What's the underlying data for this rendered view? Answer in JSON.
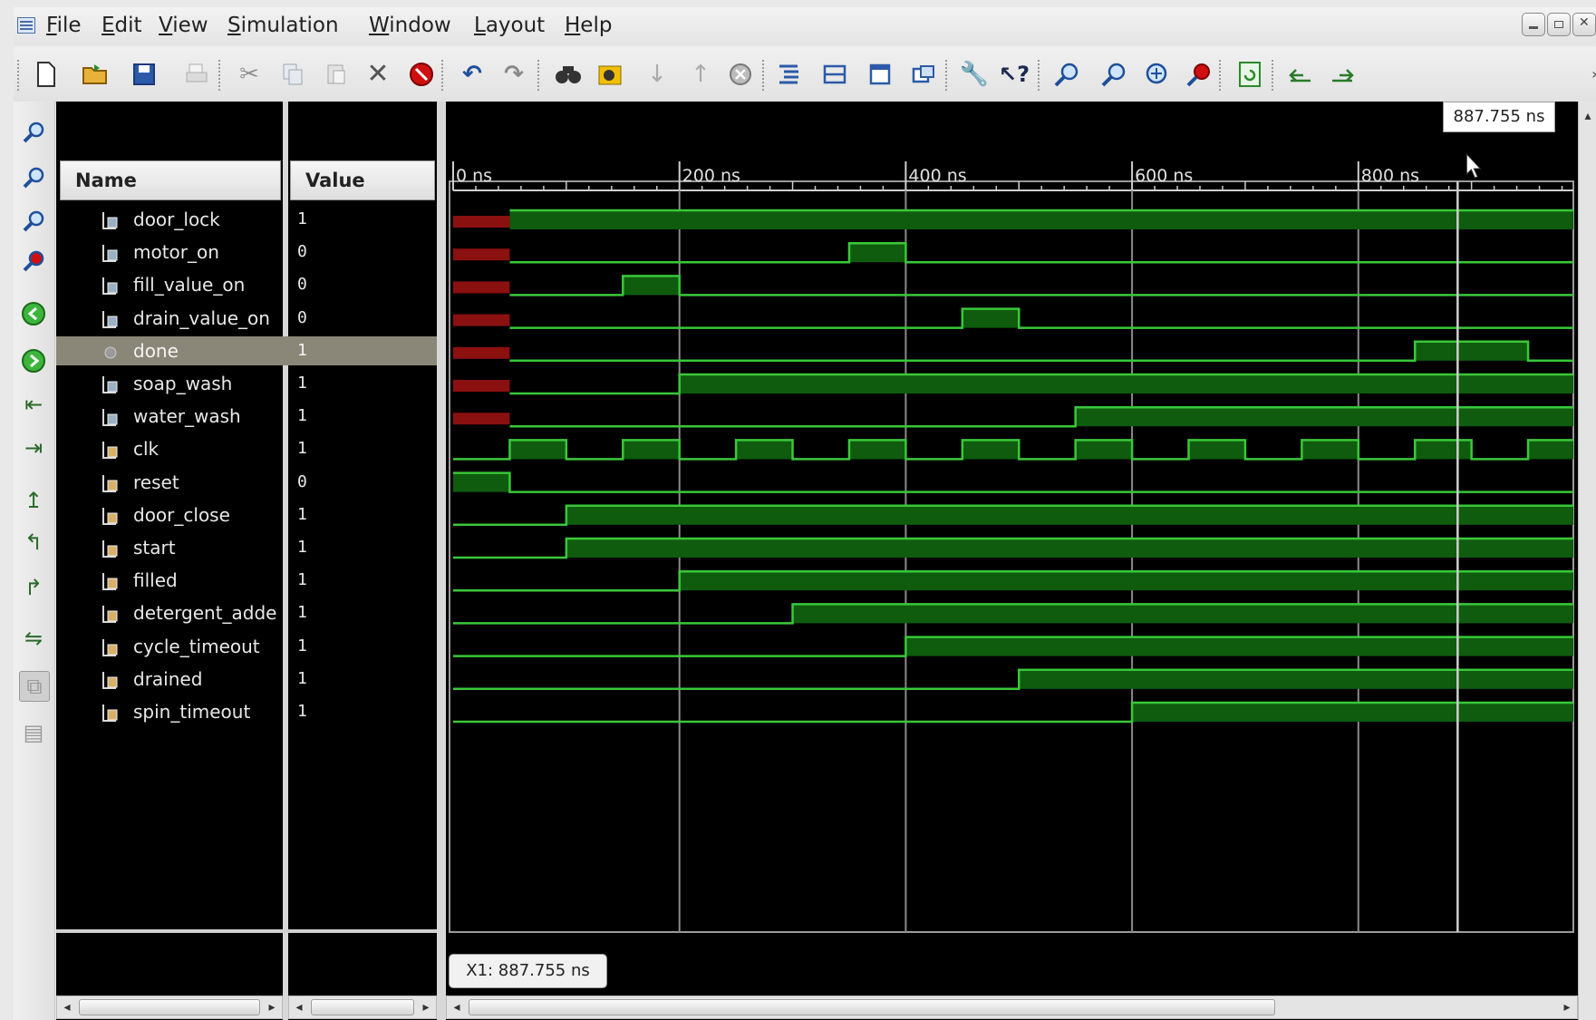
{
  "menu": [
    "File",
    "Edit",
    "View",
    "Simulation",
    "Window",
    "Layout",
    "Help"
  ],
  "toolbar_icons": [
    "new-file-icon",
    "open-folder-icon",
    "save-icon",
    "print-icon",
    "cut-icon",
    "copy-icon",
    "paste-icon",
    "delete-icon",
    "stop-icon",
    "undo-icon",
    "redo-icon",
    "find-icon",
    "find-value-icon",
    "next-transition-icon",
    "previous-transition-icon",
    "breakpoint-icon",
    "expand-bus-icon",
    "collapse-icon",
    "window-icon",
    "float-icon",
    "settings-wrench-icon",
    "help-icon",
    "zoom-in-icon",
    "zoom-out-icon",
    "zoom-fit-icon",
    "zoom-cursor-icon",
    "refresh-icon",
    "go-start-icon",
    "go-end-icon"
  ],
  "side_icons": [
    "zoom-in-icon",
    "zoom-out-icon",
    "zoom-fit-icon",
    "zoom-cursor-icon",
    "go-to-start-icon",
    "go-to-end-icon",
    "previous-marker-icon",
    "next-marker-icon",
    "add-marker-icon",
    "step-back-icon",
    "step-forward-icon",
    "swap-icon",
    "snap-icon",
    "table-icon"
  ],
  "columns": {
    "name": "Name",
    "value": "Value"
  },
  "timeline": {
    "unit": "ns",
    "start": 0,
    "end": 990,
    "major_ticks": [
      "0 ns",
      "200 ns",
      "400 ns",
      "600 ns",
      "800 ns"
    ],
    "cursor": 887.755
  },
  "cursor_label": "887.755 ns",
  "x1_label": "X1: 887.755 ns",
  "colors": {
    "wave_high": "#0f5c0f",
    "wave_line": "#39c839",
    "x_state": "#8b1010",
    "grid": "#8a8a8a",
    "cursor": "#d0d0d0",
    "selected_row": "#8a8778"
  },
  "signals": [
    {
      "name": "door_lock",
      "value": "1",
      "kind": "output",
      "initial": "X",
      "transitions": [
        [
          50,
          1
        ]
      ]
    },
    {
      "name": "motor_on",
      "value": "0",
      "kind": "output",
      "initial": "X",
      "transitions": [
        [
          50,
          0
        ],
        [
          350,
          1
        ],
        [
          400,
          0
        ]
      ]
    },
    {
      "name": "fill_value_on",
      "value": "0",
      "kind": "output",
      "initial": "X",
      "transitions": [
        [
          50,
          0
        ],
        [
          150,
          1
        ],
        [
          200,
          0
        ]
      ]
    },
    {
      "name": "drain_value_on",
      "value": "0",
      "kind": "output",
      "initial": "X",
      "transitions": [
        [
          50,
          0
        ],
        [
          450,
          1
        ],
        [
          500,
          0
        ]
      ]
    },
    {
      "name": "done",
      "value": "1",
      "kind": "output",
      "selected": true,
      "initial": "X",
      "transitions": [
        [
          50,
          0
        ],
        [
          850,
          1
        ],
        [
          950,
          0
        ]
      ]
    },
    {
      "name": "soap_wash",
      "value": "1",
      "kind": "output",
      "initial": "X",
      "transitions": [
        [
          50,
          0
        ],
        [
          200,
          1
        ]
      ]
    },
    {
      "name": "water_wash",
      "value": "1",
      "kind": "output",
      "initial": "X",
      "transitions": [
        [
          50,
          0
        ],
        [
          550,
          1
        ]
      ]
    },
    {
      "name": "clk",
      "value": "1",
      "kind": "input",
      "initial": 0,
      "transitions": [
        [
          50,
          1
        ],
        [
          100,
          0
        ],
        [
          150,
          1
        ],
        [
          200,
          0
        ],
        [
          250,
          1
        ],
        [
          300,
          0
        ],
        [
          350,
          1
        ],
        [
          400,
          0
        ],
        [
          450,
          1
        ],
        [
          500,
          0
        ],
        [
          550,
          1
        ],
        [
          600,
          0
        ],
        [
          650,
          1
        ],
        [
          700,
          0
        ],
        [
          750,
          1
        ],
        [
          800,
          0
        ],
        [
          850,
          1
        ],
        [
          900,
          0
        ],
        [
          950,
          1
        ]
      ]
    },
    {
      "name": "reset",
      "value": "0",
      "kind": "input",
      "initial": 1,
      "transitions": [
        [
          50,
          0
        ]
      ]
    },
    {
      "name": "door_close",
      "value": "1",
      "kind": "input",
      "initial": 0,
      "transitions": [
        [
          100,
          1
        ]
      ]
    },
    {
      "name": "start",
      "value": "1",
      "kind": "input",
      "initial": 0,
      "transitions": [
        [
          100,
          1
        ]
      ]
    },
    {
      "name": "filled",
      "value": "1",
      "kind": "input",
      "initial": 0,
      "transitions": [
        [
          200,
          1
        ]
      ]
    },
    {
      "name": "detergent_adde",
      "value": "1",
      "kind": "input",
      "initial": 0,
      "transitions": [
        [
          300,
          1
        ]
      ]
    },
    {
      "name": "cycle_timeout",
      "value": "1",
      "kind": "input",
      "initial": 0,
      "transitions": [
        [
          400,
          1
        ]
      ]
    },
    {
      "name": "drained",
      "value": "1",
      "kind": "input",
      "initial": 0,
      "transitions": [
        [
          500,
          1
        ]
      ]
    },
    {
      "name": "spin_timeout",
      "value": "1",
      "kind": "input",
      "initial": 0,
      "transitions": [
        [
          600,
          1
        ]
      ]
    }
  ]
}
